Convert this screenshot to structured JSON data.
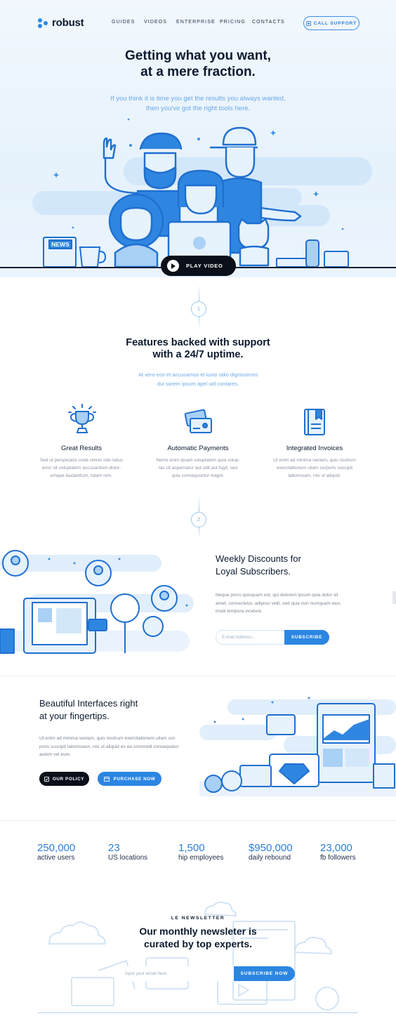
{
  "brand": {
    "name": "robust",
    "accent": "#2b86e2",
    "dark": "#0b0f19"
  },
  "nav": {
    "items": [
      "GUIDES",
      "VIDEOS",
      "ENTERPRISE",
      "PRICING",
      "CONTACTS"
    ],
    "cta": "CALL SUPPORT"
  },
  "hero": {
    "title_line1": "Getting what you want,",
    "title_line2": "at a mere fraction.",
    "sub_line1": "If you think it is time you get the results you always wanted,",
    "sub_line2": "then you've got the right tools here.",
    "play_label": "PLAY VIDEO",
    "news_sign": "NEWS"
  },
  "features": {
    "step": "1",
    "title_line1": "Features backed with support",
    "title_line2": "with a 24/7 uptime.",
    "sub_line1": "At vero eos et accusamus et iusto odio dignissimos",
    "sub_line2": "dui sorem ipsum apel uid contares.",
    "items": [
      {
        "title": "Great Results",
        "icon": "trophy-icon",
        "lines": [
          "Sed ut perspiciatis unde omnis iste natus",
          "error sit voluptatem accusantium dolor-",
          "emque laudantium, totam rem."
        ]
      },
      {
        "title": "Automatic Payments",
        "icon": "credit-card-icon",
        "lines": [
          "Nemo enim ipsam voluptatem quia volup-",
          "tas sit aspernatur aut odit aut fugit, sed",
          "quia consequuntur magni."
        ]
      },
      {
        "title": "Integrated Invoices",
        "icon": "invoice-book-icon",
        "lines": [
          "Ut enim ad minima veniam, quis nostrum",
          "exercitationem ullam corporis suscipit",
          "laboriosam, nisi ut aliquid."
        ]
      }
    ]
  },
  "discounts": {
    "step": "2",
    "title_line1": "Weekly Discounts for",
    "title_line2": "Loyal Subscribers.",
    "lines": [
      "Neque porro quisquam est, qui dolorem ipsum quia dolor sit",
      "amet, consectetur, adipisci velit, sed quia non numquam eius",
      "modi tempora incidunt."
    ],
    "email_placeholder": "E-mail Address...",
    "subscribe_label": "SUBSCRIBE"
  },
  "interfaces": {
    "title_line1": "Beautiful Interfaces right",
    "title_line2": "at your fingertips.",
    "lines": [
      "Ut enim ad minima veniam, quis nostrum exercitationem ullam cor-",
      "poris suscipit laboriosam, nisi ut aliquid ex ea commodi consequatur",
      "autem vel eum."
    ],
    "policy_label": "OUR POLICY",
    "purchase_label": "PURCHASE NOW"
  },
  "stats": [
    {
      "value": "250,000",
      "label": "active users"
    },
    {
      "value": "23",
      "label": "US locations"
    },
    {
      "value": "1,500",
      "label": "hip employees"
    },
    {
      "value": "$950,000",
      "label": "daily rebound"
    },
    {
      "value": "23,000",
      "label": "fb followers"
    }
  ],
  "newsletter": {
    "eyebrow": "LE NEWSLETTER",
    "title_line1": "Our monthly newsleter is",
    "title_line2": "curated by top experts.",
    "placeholder": "Input your email here.",
    "button": "SUBSCRIBE NOW"
  }
}
